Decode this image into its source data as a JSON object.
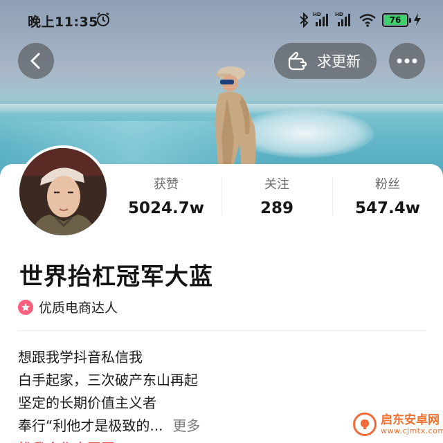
{
  "status_bar": {
    "time": "晚上11:35",
    "battery_level": "76",
    "icons": [
      "alarm-icon",
      "bluetooth-icon",
      "hd-signal-icon",
      "hd-signal-icon",
      "wifi-icon",
      "battery-icon",
      "charging-icon"
    ]
  },
  "header": {
    "back_icon": "chevron-left-icon",
    "update_button_label": "求更新",
    "update_icon": "pointing-hand-icon",
    "more_icon": "more-dots-icon"
  },
  "profile": {
    "stats": [
      {
        "label": "获赞",
        "value": "5024.7w"
      },
      {
        "label": "关注",
        "value": "289"
      },
      {
        "label": "粉丝",
        "value": "547.4w"
      }
    ],
    "name": "世界抬杠冠军大蓝",
    "badge": "优质电商达人",
    "bio": [
      "想跟我学抖音私信我",
      "白手起家，三次破产东山再起",
      "坚定的长期价值主义者",
      "奉行“利他才是极致的..."
    ],
    "bio_more": "更多",
    "bio_link": "找我合作去同同"
  },
  "watermark": {
    "text": "启东安卓网",
    "url": "www.cjmtx.com"
  },
  "colors": {
    "accent_red": "#e23a3a",
    "badge_pink": "#ff5f7e",
    "battery_green": "#3dd16b"
  }
}
